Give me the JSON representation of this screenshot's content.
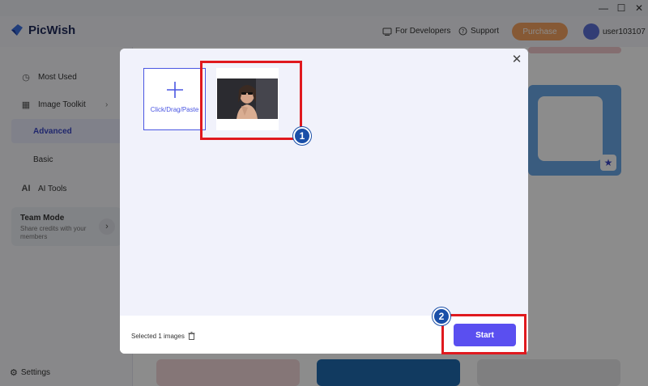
{
  "app": {
    "name": "PicWish",
    "brand_color": "#3b6fe0"
  },
  "header": {
    "developers_label": "For Developers",
    "support_label": "Support",
    "purchase_label": "Purchase",
    "username": "user103107"
  },
  "sidebar": {
    "items": [
      {
        "label": "Most Used",
        "icon": "clock-icon"
      },
      {
        "label": "Image Toolkit",
        "icon": "grid-icon"
      },
      {
        "label": "Advanced"
      },
      {
        "label": "Basic"
      },
      {
        "label": "AI Tools",
        "icon": "ai-icon"
      }
    ],
    "team_mode": {
      "title": "Team Mode",
      "description": "Share credits with your members"
    },
    "settings_label": "Settings"
  },
  "modal": {
    "add_label": "Click/Drag/Paste",
    "selected_text": "Selected 1 images",
    "start_label": "Start",
    "accent": "#5a4ff0"
  },
  "annotations": {
    "badge_1": "1",
    "badge_2": "2",
    "highlight_color": "#e0191e"
  }
}
